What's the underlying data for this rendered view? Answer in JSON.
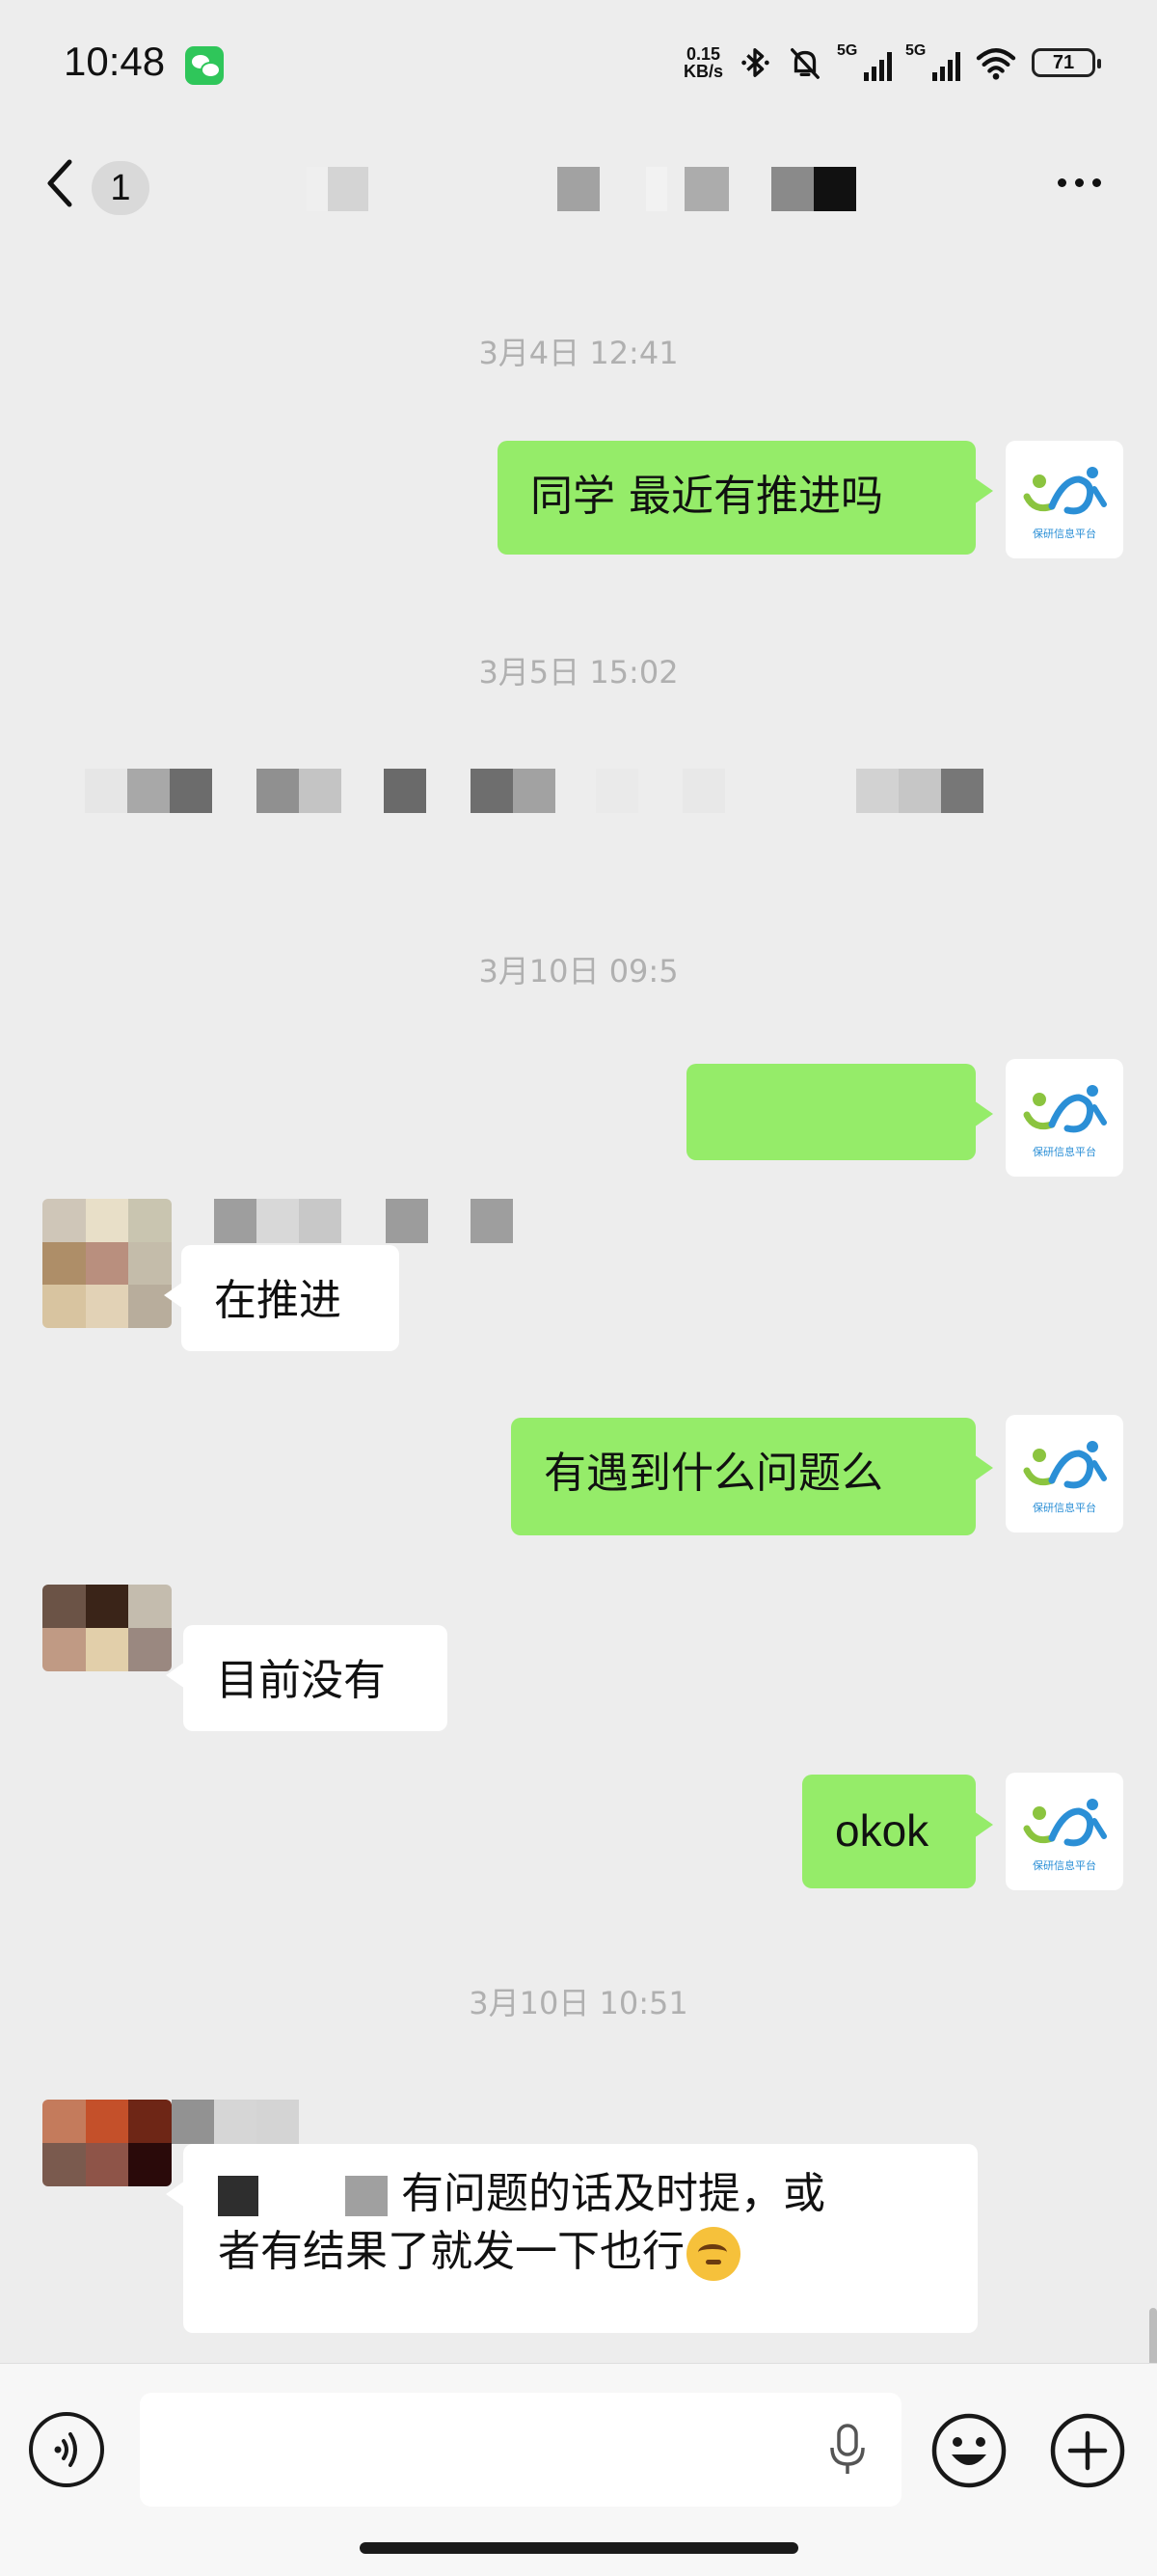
{
  "status_bar": {
    "time": "10:48",
    "net_speed_value": "0.15",
    "net_speed_unit": "KB/s",
    "network_1": "5G",
    "network_2": "5G",
    "battery": "71",
    "icons": [
      "wechat-app-icon",
      "bluetooth-icon",
      "mute-bell-icon",
      "signal-icon",
      "signal-icon",
      "wifi-icon",
      "battery-icon"
    ]
  },
  "nav": {
    "back_icon": "chevron-left-icon",
    "unread_count": "1",
    "title": "",
    "more_icon": "more-dots-icon"
  },
  "messages": [
    {
      "type": "timestamp",
      "text": "3月4日 12:41"
    },
    {
      "type": "outgoing",
      "text": "同学 最近有推进吗",
      "avatar_caption": "保研信息平台"
    },
    {
      "type": "timestamp",
      "text": "3月5日 15:02"
    },
    {
      "type": "system_obscured",
      "text": ""
    },
    {
      "type": "timestamp",
      "text": "3月10日 09:5"
    },
    {
      "type": "outgoing_obscured",
      "text": "",
      "avatar_caption": "保研信息平台"
    },
    {
      "type": "incoming",
      "sender": "",
      "text": "在推进"
    },
    {
      "type": "outgoing",
      "text": "有遇到什么问题么",
      "avatar_caption": "保研信息平台"
    },
    {
      "type": "incoming",
      "sender": "",
      "text": "目前没有"
    },
    {
      "type": "outgoing",
      "text": "okok",
      "avatar_caption": "保研信息平台"
    },
    {
      "type": "timestamp",
      "text": "3月10日 10:51"
    },
    {
      "type": "incoming",
      "sender": "",
      "text_line1": "有问题的话及时提，或",
      "text_line2": "者有结果了就发一下也行",
      "emoji": "thinking-face-emoji"
    }
  ],
  "input_bar": {
    "placeholder": "",
    "voice_icon": "voice-icon",
    "mic_icon": "microphone-icon",
    "emoji_icon": "smile-emoji-icon",
    "plus_icon": "plus-circle-icon"
  },
  "colors": {
    "background": "#ededed",
    "outgoing_bubble": "#95ec69",
    "incoming_bubble": "#ffffff",
    "timestamp_text": "#b0b0b0",
    "logo_green": "#8bc43f",
    "logo_blue": "#2b8fd6"
  }
}
